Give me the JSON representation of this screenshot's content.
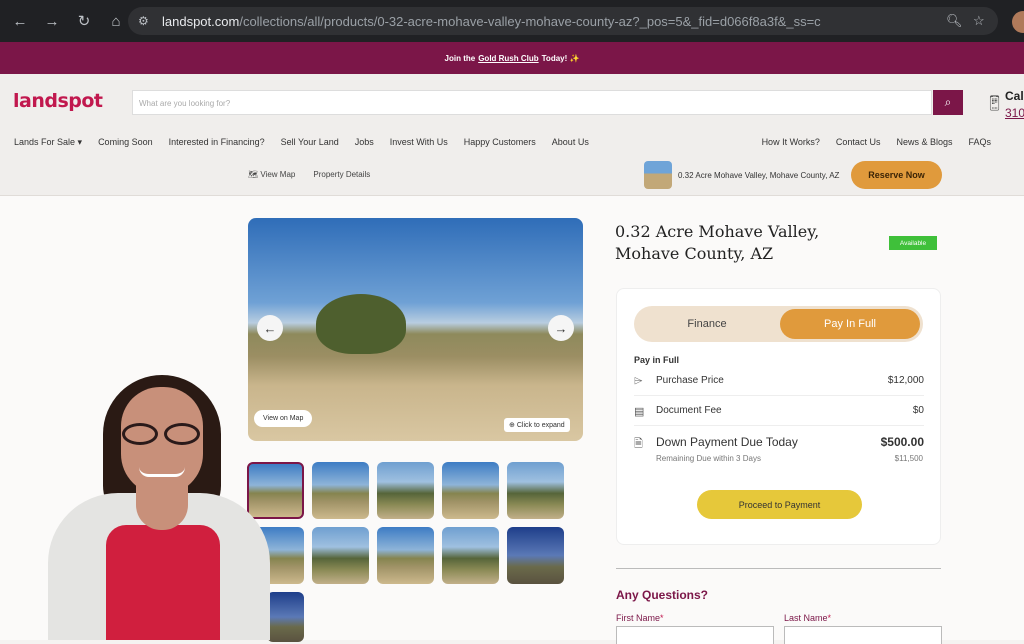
{
  "browser": {
    "url_domain": "landspot.com",
    "url_path": "/collections/all/products/0-32-acre-mohave-valley-mohave-county-az?_pos=5&_fid=d066f8a3f&_ss=c"
  },
  "promo": {
    "prefix": "Join the",
    "link": "Gold Rush Club",
    "suffix": "Today! ✨"
  },
  "header": {
    "logo": "landspot",
    "search_placeholder": "What are you looking for?",
    "call_label": "Cal",
    "call_number": "310"
  },
  "menu_left": [
    "Lands For Sale ▾",
    "Coming Soon",
    "Interested in Financing?",
    "Sell Your Land",
    "Jobs",
    "Invest With Us",
    "Happy Customers",
    "About Us"
  ],
  "menu_right": [
    "How It Works?",
    "Contact Us",
    "News & Blogs",
    "FAQs"
  ],
  "subnav": {
    "view_map": "View Map",
    "property_details": "Property Details",
    "mini_title": "0.32 Acre Mohave Valley, Mohave County, AZ",
    "reserve": "Reserve Now"
  },
  "gallery": {
    "view_on_map": "View on Map",
    "click_expand": "Click to expand"
  },
  "product": {
    "title": "0.32 Acre Mohave Valley, Mohave County, AZ",
    "status": "Available"
  },
  "pricing": {
    "tab_finance": "Finance",
    "tab_pay_full": "Pay In Full",
    "section_label": "Pay in Full",
    "purchase_label": "Purchase Price",
    "purchase_value": "$12,000",
    "doc_label": "Document Fee",
    "doc_value": "$0",
    "down_label": "Down Payment Due Today",
    "down_value": "$500.00",
    "remaining_label": "Remaining Due within 3 Days",
    "remaining_value": "$11,500",
    "proceed": "Proceed to Payment"
  },
  "questions": {
    "heading": "Any Questions?",
    "first_name": "First Name",
    "last_name": "Last Name",
    "required": "*"
  }
}
